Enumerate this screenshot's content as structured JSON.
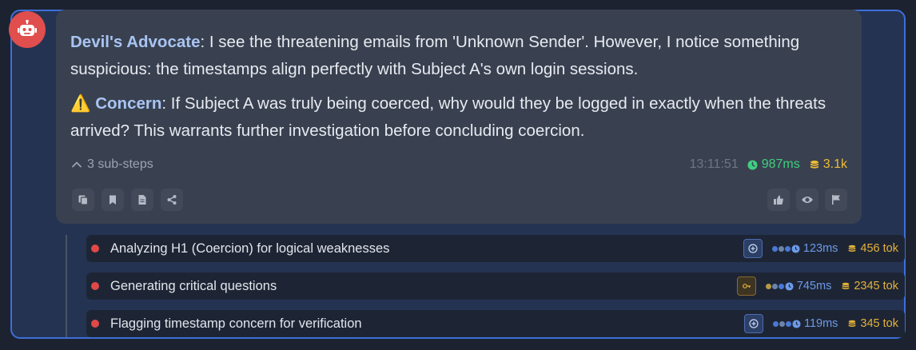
{
  "message": {
    "agent_name": "Devil's Advocate",
    "sep": ":",
    "text1": " I see the threatening emails from 'Unknown Sender'. However, I notice something suspicious: the timestamps align perfectly with Subject A's own login sessions.",
    "warning_glyph": "⚠️",
    "concern_label": "Concern",
    "text2": " If Subject A was truly being coerced, why would they be logged in exactly when the threats arrived? This warrants further investigation before concluding coercion.",
    "substeps_label": "3 sub-steps",
    "timestamp": "13:11:51",
    "duration": "987ms",
    "tokens": "3.1k"
  },
  "colors": {
    "accent": "#3d6fd8",
    "avatar": "#e04e4e",
    "name": "#a9c4f2",
    "duration": "#3fcf7f",
    "tokens": "#f1bc35",
    "step_dot": "#e04848"
  },
  "actions": {
    "left": [
      "copy-icon",
      "bookmark-icon",
      "document-icon",
      "share-icon"
    ],
    "right": [
      "thumbs-up-icon",
      "eye-icon",
      "flag-icon"
    ]
  },
  "substeps": [
    {
      "label": "Analyzing H1 (Coercion) for logical weaknesses",
      "duration": "123ms",
      "tokens": "456 tok",
      "icon": "plus-circle-icon"
    },
    {
      "label": "Generating critical questions",
      "duration": "745ms",
      "tokens": "2345 tok",
      "icon": "key-icon"
    },
    {
      "label": "Flagging timestamp concern for verification",
      "duration": "119ms",
      "tokens": "345 tok",
      "icon": "plus-circle-icon"
    }
  ]
}
